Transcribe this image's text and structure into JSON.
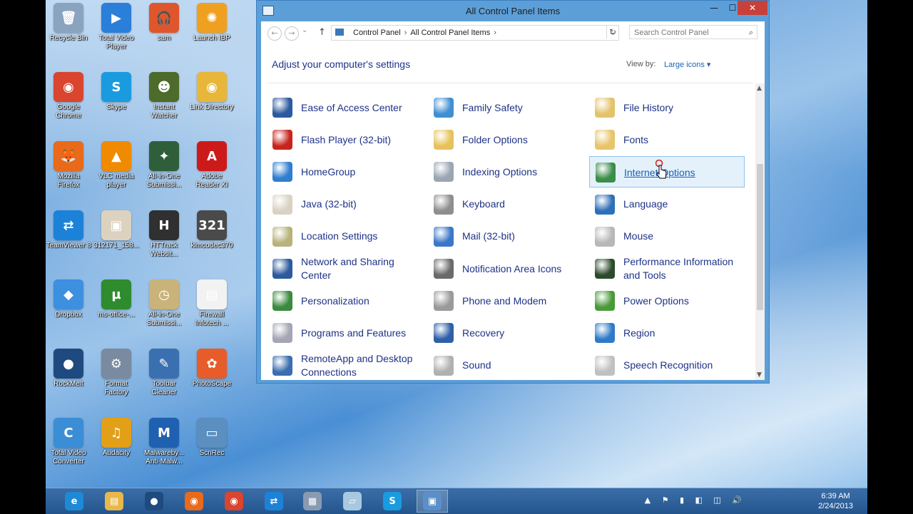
{
  "desktop_icons": [
    {
      "label": "Recycle Bin",
      "icon": "recycle-bin-icon",
      "color": "#8aa4c0",
      "glyph": "🗑"
    },
    {
      "label": "Total Video Player",
      "icon": "video-player-icon",
      "color": "#2a7fd8",
      "glyph": "▶"
    },
    {
      "label": "sam",
      "icon": "headphones-icon",
      "color": "#e0562c",
      "glyph": "🎧"
    },
    {
      "label": "Launch IBP",
      "icon": "ibp-icon",
      "color": "#f0a020",
      "glyph": "✺"
    },
    {
      "label": "Google Chrome",
      "icon": "chrome-icon",
      "color": "#d9452e",
      "glyph": "◉"
    },
    {
      "label": "Skype",
      "icon": "skype-icon",
      "color": "#1a9be0",
      "glyph": "S"
    },
    {
      "label": "Instant Watcher",
      "icon": "watcher-icon",
      "color": "#4d6b2a",
      "glyph": "☻"
    },
    {
      "label": "Link Directory",
      "icon": "folder-chrome-icon",
      "color": "#e8b73a",
      "glyph": "◉"
    },
    {
      "label": "Mozilla Firefox",
      "icon": "firefox-icon",
      "color": "#e86a1a",
      "glyph": "🦊"
    },
    {
      "label": "VLC media player",
      "icon": "vlc-icon",
      "color": "#f08a00",
      "glyph": "▲"
    },
    {
      "label": "All-in-One Submissi...",
      "icon": "submission-icon",
      "color": "#2f5f3a",
      "glyph": "✦"
    },
    {
      "label": "Adobe Reader XI",
      "icon": "adobe-reader-icon",
      "color": "#cc1a1a",
      "glyph": "A"
    },
    {
      "label": "TeamViewer 8",
      "icon": "teamviewer-icon",
      "color": "#1b82d8",
      "glyph": "⇄"
    },
    {
      "label": "312171_158...",
      "icon": "image-file-icon",
      "color": "#ddd2c0",
      "glyph": "▣"
    },
    {
      "label": "HTTrack Websit...",
      "icon": "httrack-icon",
      "color": "#303030",
      "glyph": "H"
    },
    {
      "label": "kimcodec370",
      "icon": "codec-icon",
      "color": "#4a4a4a",
      "glyph": "321"
    },
    {
      "label": "Dropbox",
      "icon": "dropbox-icon",
      "color": "#3d8fe0",
      "glyph": "◆"
    },
    {
      "label": "ms-office-...",
      "icon": "torrent-icon",
      "color": "#2e8b2e",
      "glyph": "µ"
    },
    {
      "label": "All-in-One Submissi...",
      "icon": "clock-icon",
      "color": "#c9b37a",
      "glyph": "◷"
    },
    {
      "label": "Firewall Infotech ...",
      "icon": "pdf-file-icon",
      "color": "#f2f2f2",
      "glyph": "▤"
    },
    {
      "label": "RockMelt",
      "icon": "rockmelt-icon",
      "color": "#1f4a80",
      "glyph": "●"
    },
    {
      "label": "Format Factory",
      "icon": "format-factory-icon",
      "color": "#7a8aa0",
      "glyph": "⚙"
    },
    {
      "label": "Toolbar Cleaner",
      "icon": "toolbar-cleaner-icon",
      "color": "#3a6fb0",
      "glyph": "✎"
    },
    {
      "label": "PhotoScape",
      "icon": "photoscape-icon",
      "color": "#e85c2a",
      "glyph": "✿"
    },
    {
      "label": "Total Video Converter",
      "icon": "video-converter-icon",
      "color": "#3b8ed6",
      "glyph": "C"
    },
    {
      "label": "Audacity",
      "icon": "audacity-icon",
      "color": "#e2a018",
      "glyph": "♫"
    },
    {
      "label": "Malwareby... Anti-Malw...",
      "icon": "malwarebytes-icon",
      "color": "#2060b0",
      "glyph": "M"
    },
    {
      "label": "ScnRec",
      "icon": "scnrec-icon",
      "color": "#5a8fc0",
      "glyph": "▭"
    }
  ],
  "window": {
    "title": "All Control Panel Items",
    "min": "—",
    "max": "☐",
    "close": "✕"
  },
  "addressbar": {
    "back": "←",
    "forward": "→",
    "history": "⌄",
    "up": "↑",
    "crumbs": [
      "Control Panel",
      "All Control Panel Items"
    ],
    "crumb_sep": "›",
    "dropdown": "⌄",
    "refresh": "↻",
    "search_placeholder": "Search Control Panel",
    "search_icon": "⌕"
  },
  "content": {
    "heading": "Adjust your computer's settings",
    "view_by_label": "View by:",
    "view_by_value": "Large icons ▾"
  },
  "items": [
    {
      "label": "Ease of Access Center",
      "icon": "ease-of-access-icon",
      "color": "#2c5aa0"
    },
    {
      "label": "Family Safety",
      "icon": "family-safety-icon",
      "color": "#3f8fd2"
    },
    {
      "label": "File History",
      "icon": "file-history-icon",
      "color": "#e3c36a"
    },
    {
      "label": "Flash Player (32-bit)",
      "icon": "flash-player-icon",
      "color": "#c8241e"
    },
    {
      "label": "Folder Options",
      "icon": "folder-options-icon",
      "color": "#e7c25b"
    },
    {
      "label": "Fonts",
      "icon": "fonts-icon",
      "color": "#e8c46a"
    },
    {
      "label": "HomeGroup",
      "icon": "homegroup-icon",
      "color": "#2f7ed0"
    },
    {
      "label": "Indexing Options",
      "icon": "indexing-options-icon",
      "color": "#9aa6b3"
    },
    {
      "label": "Internet Options",
      "icon": "internet-options-icon",
      "color": "#3a8e4a"
    },
    {
      "label": "Java (32-bit)",
      "icon": "java-icon",
      "color": "#d9d2c3"
    },
    {
      "label": "Keyboard",
      "icon": "keyboard-icon",
      "color": "#8e8e8e"
    },
    {
      "label": "Language",
      "icon": "language-icon",
      "color": "#2f6fb8"
    },
    {
      "label": "Location Settings",
      "icon": "location-settings-icon",
      "color": "#b9b27a"
    },
    {
      "label": "Mail (32-bit)",
      "icon": "mail-icon",
      "color": "#3b77c8"
    },
    {
      "label": "Mouse",
      "icon": "mouse-icon",
      "color": "#b8b8b8"
    },
    {
      "label": "Network and Sharing Center",
      "icon": "network-sharing-icon",
      "color": "#2d5a9c"
    },
    {
      "label": "Notification Area Icons",
      "icon": "notification-area-icon",
      "color": "#6a6a6a"
    },
    {
      "label": "Performance Information and Tools",
      "icon": "performance-icon",
      "color": "#2c4a2c"
    },
    {
      "label": "Personalization",
      "icon": "personalization-icon",
      "color": "#3b8a3f"
    },
    {
      "label": "Phone and Modem",
      "icon": "phone-modem-icon",
      "color": "#9a9a9a"
    },
    {
      "label": "Power Options",
      "icon": "power-options-icon",
      "color": "#4a9a3a"
    },
    {
      "label": "Programs and Features",
      "icon": "programs-features-icon",
      "color": "#a5a5b5"
    },
    {
      "label": "Recovery",
      "icon": "recovery-icon",
      "color": "#2f5fa8"
    },
    {
      "label": "Region",
      "icon": "region-icon",
      "color": "#2f7ac8"
    },
    {
      "label": "RemoteApp and Desktop Connections",
      "icon": "remoteapp-icon",
      "color": "#3a6eb0"
    },
    {
      "label": "Sound",
      "icon": "sound-icon",
      "color": "#b0b0b0"
    },
    {
      "label": "Speech Recognition",
      "icon": "speech-recognition-icon",
      "color": "#c0c0c0"
    }
  ],
  "selected_item": "Internet Options",
  "taskbar": {
    "apps": [
      {
        "name": "internet-explorer",
        "icon": "internet-explorer-icon",
        "color": "#1e8ad6",
        "glyph": "e"
      },
      {
        "name": "file-explorer",
        "icon": "file-explorer-icon",
        "color": "#e8b84a",
        "glyph": "▤"
      },
      {
        "name": "rockmelt",
        "icon": "rockmelt-icon",
        "color": "#1f4a80",
        "glyph": "●"
      },
      {
        "name": "firefox",
        "icon": "firefox-icon",
        "color": "#e86a1a",
        "glyph": "◉"
      },
      {
        "name": "chrome",
        "icon": "chrome-icon",
        "color": "#d9452e",
        "glyph": "◉"
      },
      {
        "name": "teamviewer",
        "icon": "teamviewer-icon",
        "color": "#1b82d8",
        "glyph": "⇄"
      },
      {
        "name": "calculator",
        "icon": "calculator-icon",
        "color": "#8a9ab0",
        "glyph": "▦"
      },
      {
        "name": "notes",
        "icon": "notes-icon",
        "color": "#a8c8e0",
        "glyph": "▱"
      },
      {
        "name": "skype",
        "icon": "skype-icon",
        "color": "#1a9be0",
        "glyph": "S"
      },
      {
        "name": "control-panel",
        "icon": "control-panel-icon",
        "color": "#5c8fc8",
        "glyph": "▣"
      }
    ],
    "tray_icons": "▲ ⚑ ▮ ◧ ◫ 🔊",
    "time": "6:39 AM",
    "date": "2/24/2013"
  }
}
